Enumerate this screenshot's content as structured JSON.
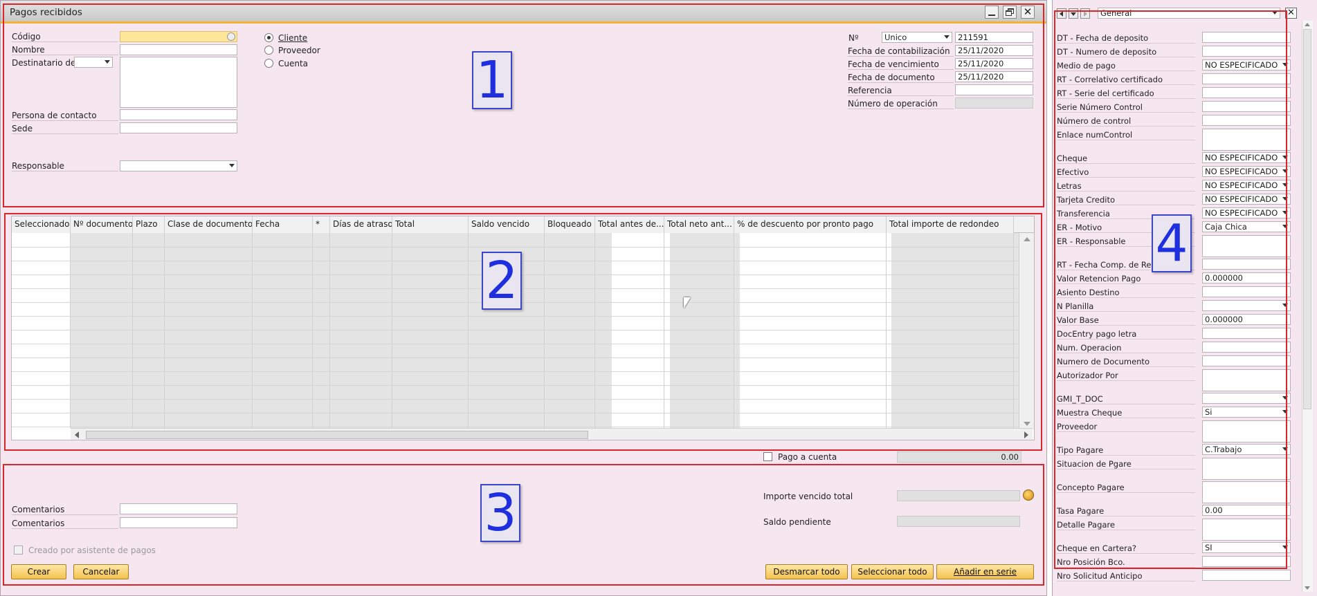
{
  "window": {
    "title": "Pagos recibidos"
  },
  "header": {
    "codigo_label": "Código",
    "nombre_label": "Nombre",
    "destinatario_label": "Destinatario de f",
    "persona_label": "Persona de contacto",
    "sede_label": "Sede",
    "responsable_label": "Responsable",
    "radio_cliente": "Cliente",
    "radio_proveedor": "Proveedor",
    "radio_cuenta": "Cuenta",
    "no_label": "Nº",
    "no_series": "Unico",
    "no_value": "211591",
    "fecha_contab_label": "Fecha de contabilización",
    "fecha_contab_value": "25/11/2020",
    "fecha_venc_label": "Fecha de vencimiento",
    "fecha_venc_value": "25/11/2020",
    "fecha_doc_label": "Fecha de documento",
    "fecha_doc_value": "25/11/2020",
    "referencia_label": "Referencia",
    "num_operacion_label": "Número de operación"
  },
  "grid": {
    "columns": [
      "Seleccionado",
      "Nº documento",
      "Plazo",
      "Clase de documento",
      "Fecha",
      "*",
      "Días de atraso",
      "Total",
      "Saldo vencido",
      "Bloqueado",
      "Total antes de...",
      "Total neto ant...",
      "% de descuento por pronto pago",
      "Total importe de redondeo"
    ]
  },
  "footer": {
    "pago_cuenta_label": "Pago a cuenta",
    "pago_cuenta_value": "0.00",
    "comentarios1_label": "Comentarios",
    "comentarios2_label": "Comentarios",
    "creado_label": "Creado por asistente de pagos",
    "importe_label": "Importe vencido total",
    "saldo_label": "Saldo pendiente",
    "crear": "Crear",
    "cancelar": "Cancelar",
    "desmarcar": "Desmarcar todo",
    "seleccionar": "Seleccionar todo",
    "anadir": "Añadir en serie"
  },
  "udf": {
    "category": "General",
    "rows": [
      {
        "label": "DT - Fecha de deposito",
        "value": "",
        "type": "text"
      },
      {
        "label": "DT - Numero de deposito",
        "value": "",
        "type": "text"
      },
      {
        "label": "Medio de pago",
        "value": "NO ESPECIFICADO",
        "type": "select"
      },
      {
        "label": "RT - Correlativo certificado",
        "value": "",
        "type": "text"
      },
      {
        "label": "RT - Serie del certificado",
        "value": "",
        "type": "text"
      },
      {
        "label": "Serie Número Control",
        "value": "",
        "type": "text"
      },
      {
        "label": "Número de control",
        "value": "",
        "type": "text"
      },
      {
        "label": "Enlace numControl",
        "value": "",
        "type": "tall"
      },
      {
        "label": "Cheque",
        "value": "NO ESPECIFICADO",
        "type": "select"
      },
      {
        "label": "Efectivo",
        "value": "NO ESPECIFICADO",
        "type": "select"
      },
      {
        "label": "Letras",
        "value": "NO ESPECIFICADO",
        "type": "select"
      },
      {
        "label": "Tarjeta Credito",
        "value": "NO ESPECIFICADO",
        "type": "select"
      },
      {
        "label": "Transferencia",
        "value": "NO ESPECIFICADO",
        "type": "select"
      },
      {
        "label": "ER - Motivo",
        "value": "Caja Chica",
        "type": "select"
      },
      {
        "label": "ER - Responsable",
        "value": "",
        "type": "tall"
      },
      {
        "label": "RT - Fecha Comp. de Re",
        "value": "",
        "type": "text"
      },
      {
        "label": "Valor Retencion Pago",
        "value": "0.000000",
        "type": "text"
      },
      {
        "label": "Asiento Destino",
        "value": "",
        "type": "text"
      },
      {
        "label": "N Planilla",
        "value": "",
        "type": "select"
      },
      {
        "label": "Valor Base",
        "value": "0.000000",
        "type": "text"
      },
      {
        "label": "DocEntry pago letra",
        "value": "",
        "type": "text"
      },
      {
        "label": "Num. Operacion",
        "value": "",
        "type": "text"
      },
      {
        "label": "Numero de Documento",
        "value": "",
        "type": "text"
      },
      {
        "label": "Autorizador Por",
        "value": "",
        "type": "tall"
      },
      {
        "label": "GMI_T_DOC",
        "value": "",
        "type": "select"
      },
      {
        "label": "Muestra Cheque",
        "value": "Si",
        "type": "select"
      },
      {
        "label": "Proveedor",
        "value": "",
        "type": "tall"
      },
      {
        "label": "Tipo Pagare",
        "value": "C.Trabajo",
        "type": "select"
      },
      {
        "label": "Situacion de Pgare",
        "value": "",
        "type": "tall"
      },
      {
        "label": "Concepto Pagare",
        "value": "",
        "type": "tall"
      },
      {
        "label": "Tasa Pagare",
        "value": "0.00",
        "type": "text"
      },
      {
        "label": "Detalle Pagare",
        "value": "",
        "type": "tall"
      },
      {
        "label": "Cheque en Cartera?",
        "value": "SI",
        "type": "select"
      },
      {
        "label": "Nro Posición Bco.",
        "value": "",
        "type": "text"
      },
      {
        "label": "Nro Solicitud Anticipo",
        "value": "",
        "type": "text"
      }
    ]
  },
  "annotations": {
    "a1": "1",
    "a2": "2",
    "a3": "3",
    "a4": "4"
  },
  "colors": {
    "panel_bg": "#f6e6f0",
    "accent": "#f4c14f",
    "annotation_border": "#d9262b"
  }
}
